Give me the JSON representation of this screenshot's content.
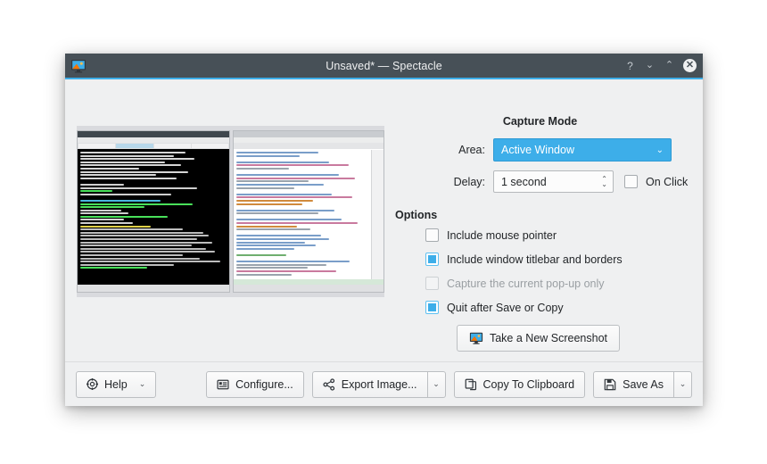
{
  "window": {
    "title": "Unsaved* — Spectacle",
    "app_icon": "spectacle-monitor-icon",
    "controls": {
      "help": "?",
      "minimize": "⌄",
      "maximize": "⌃",
      "close": "✕"
    }
  },
  "accent_color": "#3daee9",
  "titlebar_color": "#475057",
  "background_color": "#eff0f1",
  "preview": {
    "name": "screenshot-preview-thumbnail",
    "description": "Screenshot preview of a dark terminal window beside a light code editor window"
  },
  "capture_mode": {
    "heading": "Capture Mode",
    "area": {
      "label": "Area:",
      "value": "Active Window",
      "caret": "⌄"
    },
    "delay": {
      "label": "Delay:",
      "value": "1 second",
      "up": "⌃",
      "down": "⌄"
    },
    "on_click": {
      "label": "On Click",
      "checked": false
    }
  },
  "options": {
    "heading": "Options",
    "items": [
      {
        "label": "Include mouse pointer",
        "checked": false,
        "disabled": false
      },
      {
        "label": "Include window titlebar and borders",
        "checked": true,
        "disabled": false
      },
      {
        "label": "Capture the current pop-up only",
        "checked": false,
        "disabled": true
      },
      {
        "label": "Quit after Save or Copy",
        "checked": true,
        "disabled": false
      }
    ]
  },
  "take_screenshot": {
    "label": "Take a New Screenshot",
    "icon": "screenshot-monitor-icon"
  },
  "buttonbar": {
    "help": {
      "label": "Help",
      "icon": "help-icon",
      "arrow": "⌄"
    },
    "configure": {
      "label": "Configure...",
      "icon": "configure-icon"
    },
    "export": {
      "label": "Export Image...",
      "icon": "share-icon",
      "arrow": "⌄"
    },
    "copy": {
      "label": "Copy To Clipboard",
      "icon": "copy-icon"
    },
    "save_as": {
      "label": "Save As",
      "icon": "save-icon",
      "arrow": "⌄"
    }
  }
}
